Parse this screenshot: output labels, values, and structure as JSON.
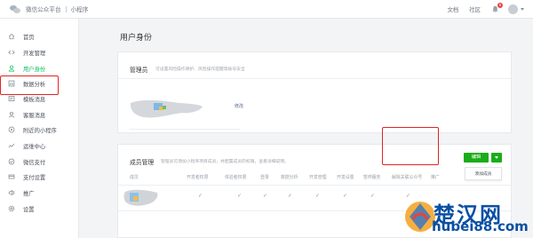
{
  "header": {
    "brand_name": "微信公众平台",
    "brand_product": "小程序",
    "links": [
      "文档",
      "社区"
    ],
    "notification_count": "6"
  },
  "sidebar": {
    "items": [
      {
        "label": "首页",
        "icon": "home-icon"
      },
      {
        "label": "开发管理",
        "icon": "code-icon"
      },
      {
        "label": "用户身份",
        "icon": "user-icon",
        "active": true
      },
      {
        "label": "数据分析",
        "icon": "chart-icon"
      },
      {
        "label": "模板消息",
        "icon": "template-icon"
      },
      {
        "label": "客服消息",
        "icon": "customer-service-icon"
      },
      {
        "label": "附近的小程序",
        "icon": "location-icon"
      },
      {
        "label": "运维中心",
        "icon": "ops-icon"
      },
      {
        "label": "微信支付",
        "icon": "wechat-pay-icon"
      },
      {
        "label": "支付设置",
        "icon": "payment-settings-icon"
      },
      {
        "label": "推广",
        "icon": "promote-icon"
      },
      {
        "label": "设置",
        "icon": "settings-icon"
      }
    ]
  },
  "main": {
    "title": "用户身份",
    "admin": {
      "title": "管理员",
      "desc": "可设置风险操作保护、风险操作提醒等账号安全",
      "modify_link": "修改"
    },
    "members": {
      "title": "成员管理",
      "desc": "管理员可添加小程序项目成员，并配置成员的权限，查看详细说明。",
      "edit_button": "编辑",
      "dropdown_item": "添加成员",
      "columns": [
        "成员",
        "开发者权限",
        "体验者权限",
        "登录",
        "数据分析",
        "开发管理",
        "开发设置",
        "暂停服务",
        "解除关联公众号",
        "推广"
      ],
      "check_mark": "✓"
    }
  },
  "watermark": {
    "text": "楚汉网",
    "url": "hubei88.com"
  },
  "colors": {
    "accent": "#07c160",
    "button": "#1aad19",
    "highlight": "#e02424",
    "link": "#576b95"
  }
}
